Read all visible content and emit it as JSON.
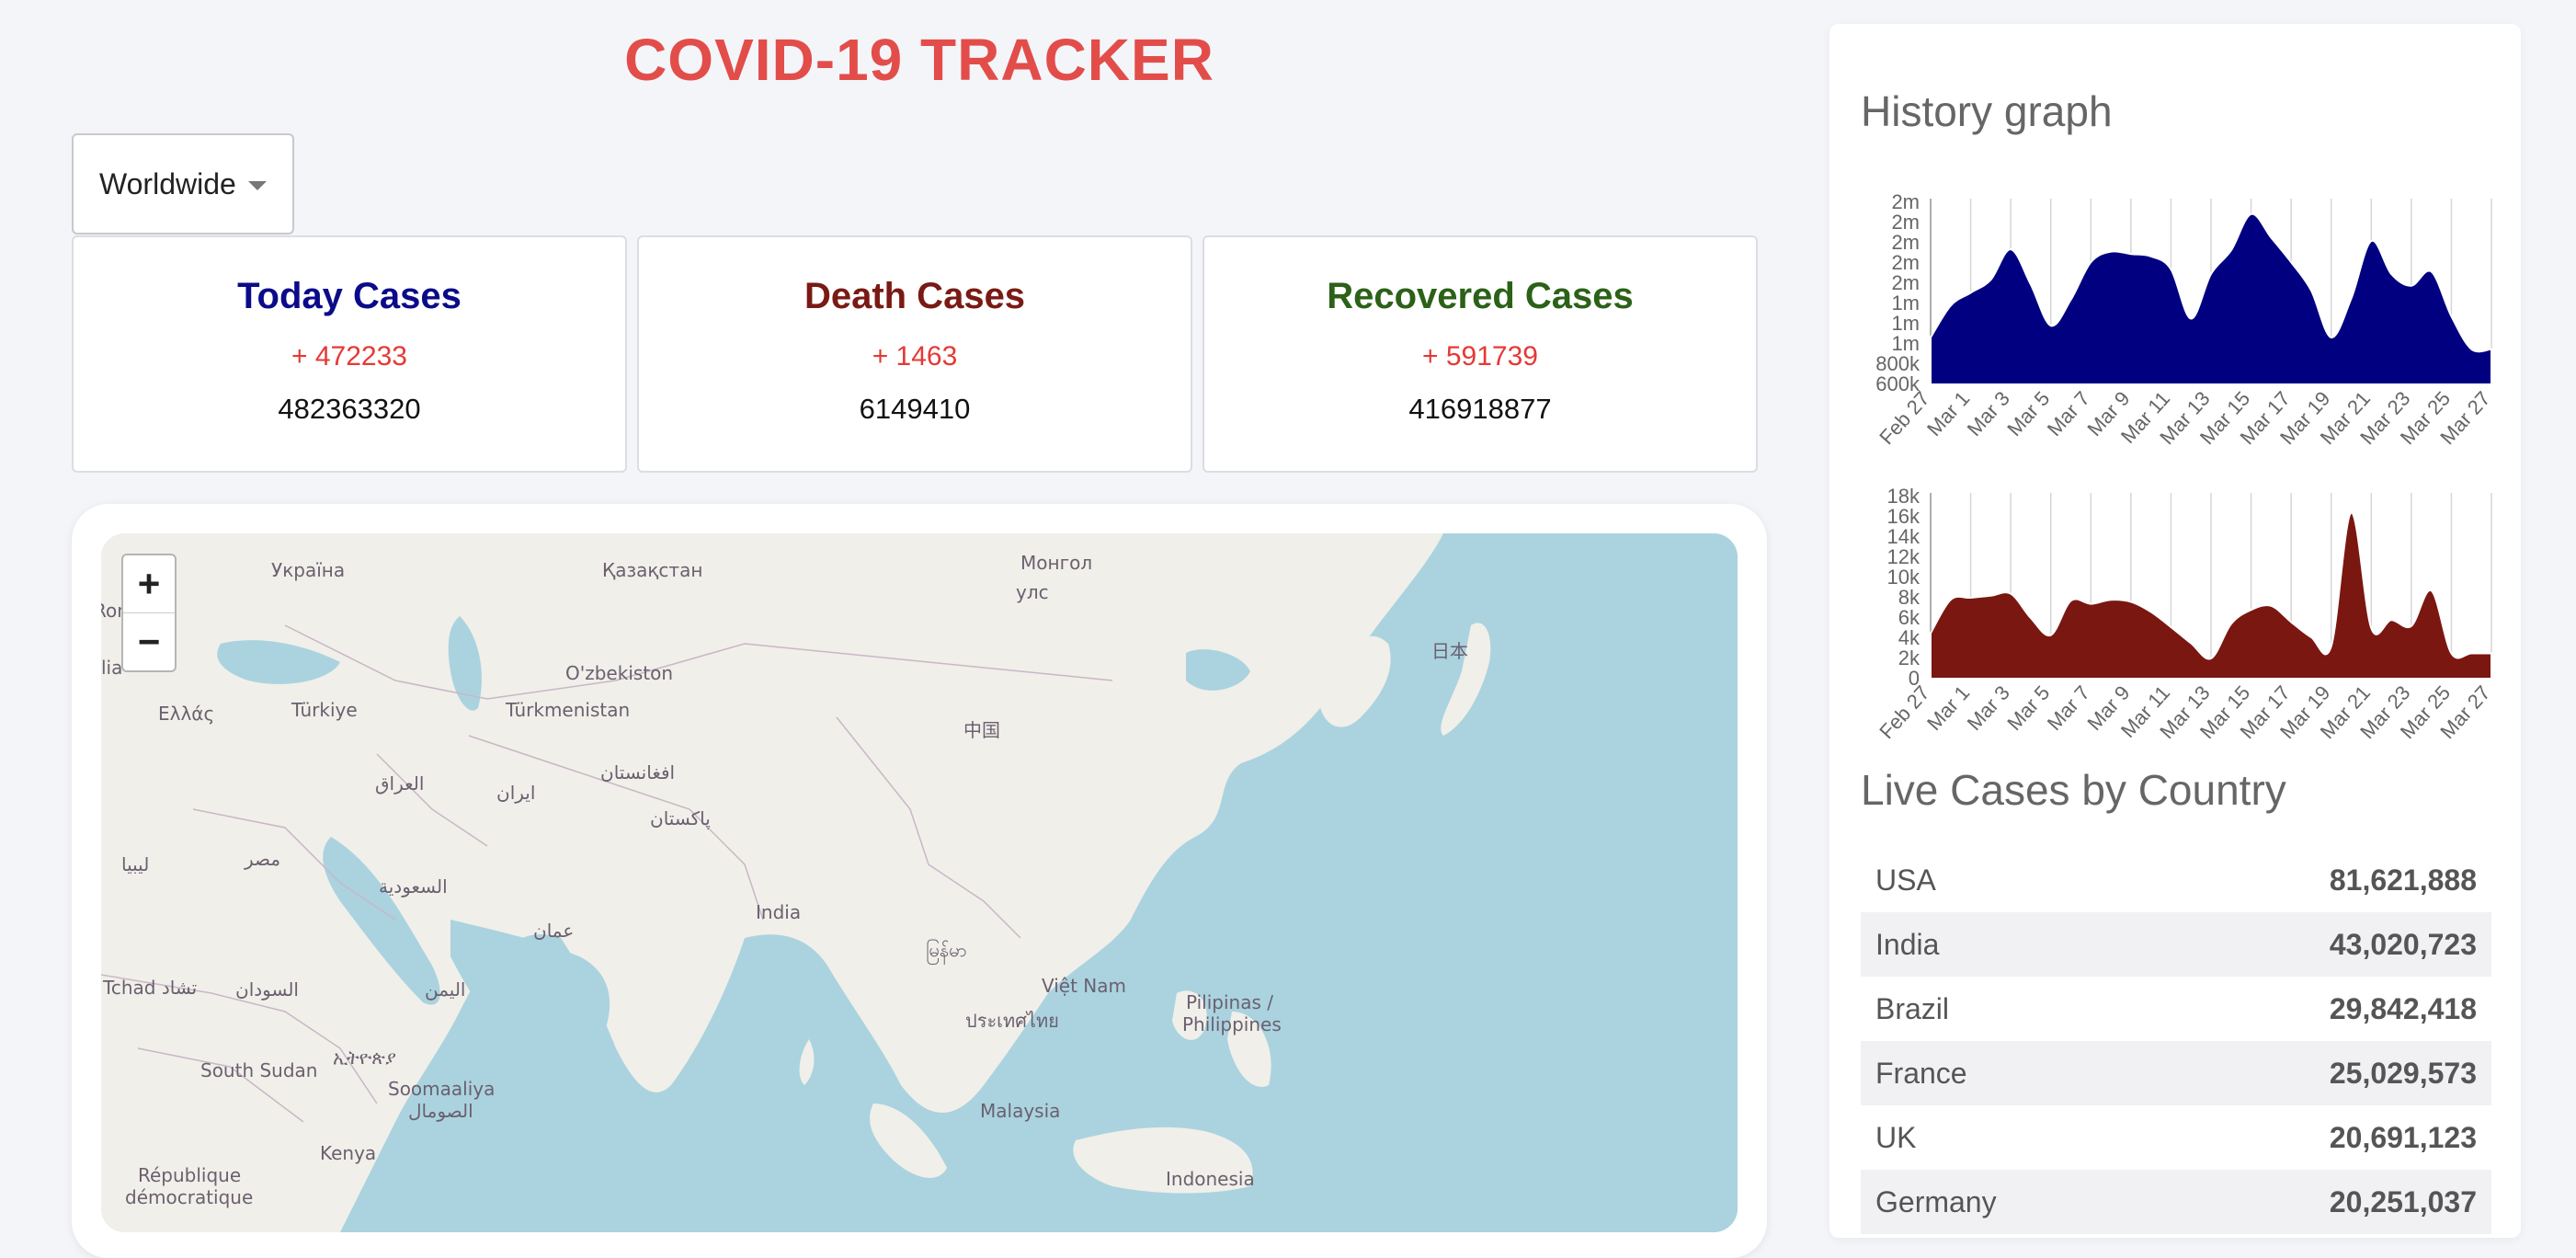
{
  "app_title": "COVID-19 TRACKER",
  "country_select": {
    "value": "Worldwide"
  },
  "cards": {
    "today": {
      "title": "Today Cases",
      "delta": "+ 472233",
      "total": "482363320",
      "color": "#0b0b8a"
    },
    "death": {
      "title": "Death Cases",
      "delta": "+ 1463",
      "total": "6149410",
      "color": "#7a1a14"
    },
    "recovered": {
      "title": "Recovered Cases",
      "delta": "+ 591739",
      "total": "416918877",
      "color": "#2c6118"
    }
  },
  "map": {
    "zoom_in": "+",
    "zoom_out": "−",
    "labels": [
      "Україна",
      "Қазақстан",
      "Монгол",
      "улс",
      "România",
      "O'zbekiston",
      "Türkmenistan",
      "Türkiye",
      "Ελλάς",
      "中国",
      "日本",
      "العراق",
      "ایران",
      "افغانستان",
      "پاکستان",
      "ليبيا",
      "مصر",
      "السعودية",
      "عمان",
      "India",
      "မြန်မာ",
      "Việt Nam",
      "Pilipinas /",
      "Philippines",
      "Tchad تشاد",
      "السودان",
      "اليمن",
      "ประเทศไทย",
      "ኢትዮጵያ",
      "South Sudan",
      "Soomaaliya",
      "الصومال",
      "Malaysia",
      "Kenya",
      "République",
      "démocratique",
      "Indonesia",
      "lia"
    ]
  },
  "sidebar": {
    "history_title": "History graph",
    "live_title": "Live Cases by Country",
    "countries": [
      {
        "name": "USA",
        "cases": "81,621,888"
      },
      {
        "name": "India",
        "cases": "43,020,723"
      },
      {
        "name": "Brazil",
        "cases": "29,842,418"
      },
      {
        "name": "France",
        "cases": "25,029,573"
      },
      {
        "name": "UK",
        "cases": "20,691,123"
      },
      {
        "name": "Germany",
        "cases": "20,251,037"
      }
    ]
  },
  "chart_data": [
    {
      "type": "area",
      "title": "",
      "color": "#000080",
      "y_tick_labels": [
        "2m",
        "2m",
        "2m",
        "2m",
        "2m",
        "1m",
        "1m",
        "1m",
        "800k",
        "600k"
      ],
      "x": [
        "Feb 27",
        "Feb 28",
        "Mar 1",
        "Mar 2",
        "Mar 3",
        "Mar 4",
        "Mar 5",
        "Mar 6",
        "Mar 7",
        "Mar 8",
        "Mar 9",
        "Mar 10",
        "Mar 11",
        "Mar 12",
        "Mar 13",
        "Mar 14",
        "Mar 15",
        "Mar 16",
        "Mar 17",
        "Mar 18",
        "Mar 19",
        "Mar 20",
        "Mar 21",
        "Mar 22",
        "Mar 23",
        "Mar 24",
        "Mar 25",
        "Mar 26",
        "Mar 27"
      ],
      "x_tick_labels": [
        "Feb 27",
        "Mar 1",
        "Mar 3",
        "Mar 5",
        "Mar 7",
        "Mar 9",
        "Mar 11",
        "Mar 13",
        "Mar 15",
        "Mar 17",
        "Mar 19",
        "Mar 21",
        "Mar 23",
        "Mar 25",
        "Mar 27"
      ],
      "values": [
        1000000,
        1270000,
        1380000,
        1490000,
        1750000,
        1450000,
        1100000,
        1320000,
        1640000,
        1730000,
        1710000,
        1690000,
        1580000,
        1160000,
        1540000,
        1740000,
        2050000,
        1850000,
        1640000,
        1400000,
        1000000,
        1330000,
        1820000,
        1540000,
        1440000,
        1560000,
        1180000,
        900000,
        900000
      ],
      "ylim": [
        600000,
        2150000
      ]
    },
    {
      "type": "area",
      "title": "",
      "color": "#7a1710",
      "y_tick_labels": [
        "18k",
        "16k",
        "14k",
        "12k",
        "10k",
        "8k",
        "6k",
        "4k",
        "2k",
        "0"
      ],
      "x": [
        "Feb 27",
        "Feb 28",
        "Mar 1",
        "Mar 2",
        "Mar 3",
        "Mar 4",
        "Mar 5",
        "Mar 6",
        "Mar 7",
        "Mar 8",
        "Mar 9",
        "Mar 10",
        "Mar 11",
        "Mar 12",
        "Mar 13",
        "Mar 14",
        "Mar 15",
        "Mar 16",
        "Mar 17",
        "Mar 18",
        "Mar 19",
        "Mar 20",
        "Mar 21",
        "Mar 22",
        "Mar 23",
        "Mar 24",
        "Mar 25",
        "Mar 26",
        "Mar 27"
      ],
      "x_tick_labels": [
        "Feb 27",
        "Mar 1",
        "Mar 3",
        "Mar 5",
        "Mar 7",
        "Mar 9",
        "Mar 11",
        "Mar 13",
        "Mar 15",
        "Mar 17",
        "Mar 19",
        "Mar 21",
        "Mar 23",
        "Mar 25",
        "Mar 27"
      ],
      "values": [
        4500,
        7800,
        8000,
        8200,
        8400,
        6000,
        4300,
        7700,
        7400,
        7800,
        7600,
        6600,
        5100,
        3500,
        2000,
        5400,
        6800,
        7200,
        5600,
        4100,
        3200,
        16400,
        5000,
        5800,
        5200,
        8700,
        2500,
        2500,
        2500
      ],
      "ylim": [
        0,
        18000
      ]
    }
  ]
}
